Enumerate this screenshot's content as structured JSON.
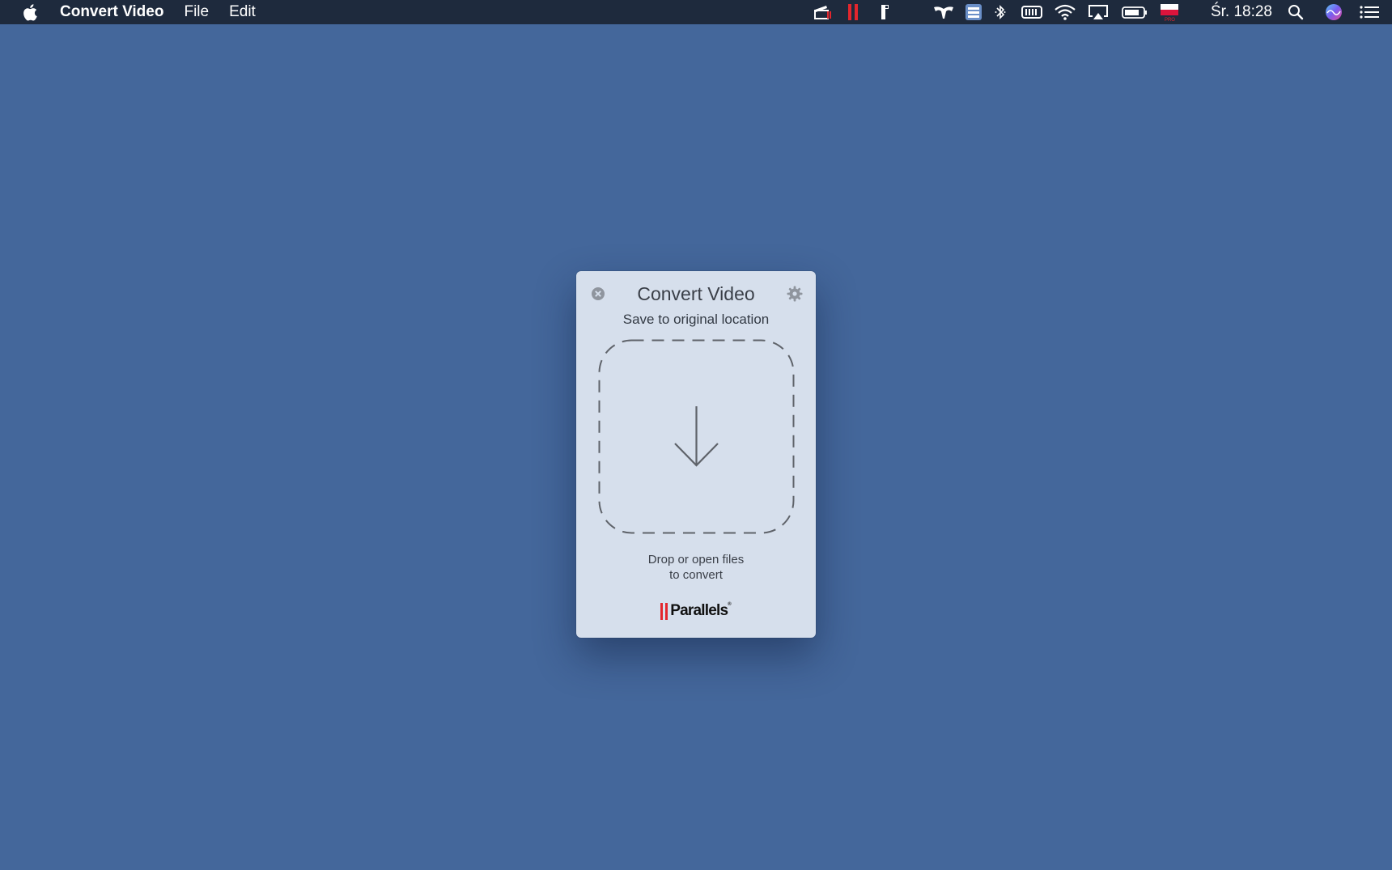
{
  "menubar": {
    "app_name": "Convert Video",
    "menus": [
      "File",
      "Edit"
    ],
    "clock": "Śr. 18:28",
    "flag_badge": "PRO",
    "status_icons": [
      "parallels-toolbox-icon",
      "parallels-icon",
      "app-status-icon",
      "bartender-icon",
      "list-menu-icon",
      "bluetooth-icon",
      "keyboard-icon",
      "wifi-icon",
      "airplay-icon",
      "battery-icon",
      "poland-flag-icon",
      "spotlight-search-icon",
      "siri-icon",
      "notification-center-icon"
    ]
  },
  "window": {
    "title": "Convert Video",
    "subtitle": "Save to original location",
    "drop_line1": "Drop or open files",
    "drop_line2": "to convert",
    "brand": "Parallels",
    "brand_mark": "®"
  },
  "colors": {
    "desktop": "#44679b",
    "menubar": "#1e2a3d",
    "window_bg": "#d6dfec",
    "accent_red": "#e3262d"
  }
}
